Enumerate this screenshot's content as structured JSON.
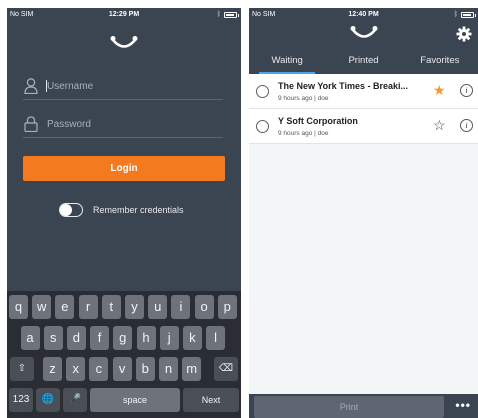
{
  "left": {
    "status": {
      "carrier": "No SIM",
      "time": "12:29 PM"
    },
    "username": {
      "placeholder": "Username"
    },
    "password": {
      "placeholder": "Password"
    },
    "login_label": "Login",
    "remember_label": "Remember credentials",
    "keyboard": {
      "row1": [
        "q",
        "w",
        "e",
        "r",
        "t",
        "y",
        "u",
        "i",
        "o",
        "p"
      ],
      "row2": [
        "a",
        "s",
        "d",
        "f",
        "g",
        "h",
        "j",
        "k",
        "l"
      ],
      "row3": [
        "z",
        "x",
        "c",
        "v",
        "b",
        "n",
        "m"
      ],
      "numbers_label": "123",
      "space_label": "space",
      "next_label": "Next"
    }
  },
  "right": {
    "status": {
      "carrier": "No SIM",
      "time": "12:40 PM"
    },
    "tabs": [
      "Waiting",
      "Printed",
      "Favorites"
    ],
    "active_tab": "Waiting",
    "jobs": [
      {
        "title": "The New York Times - Breaki...",
        "meta": "9 hours ago | doe",
        "favorite": true
      },
      {
        "title": "Y Soft Corporation",
        "meta": "9 hours ago | doe",
        "favorite": false
      }
    ],
    "print_label": "Print",
    "more_label": "•••"
  },
  "colors": {
    "header": "#3b4451",
    "accent": "#f47a20",
    "tab_underline": "#48a8e0",
    "keyboard": "#2a2e34"
  }
}
